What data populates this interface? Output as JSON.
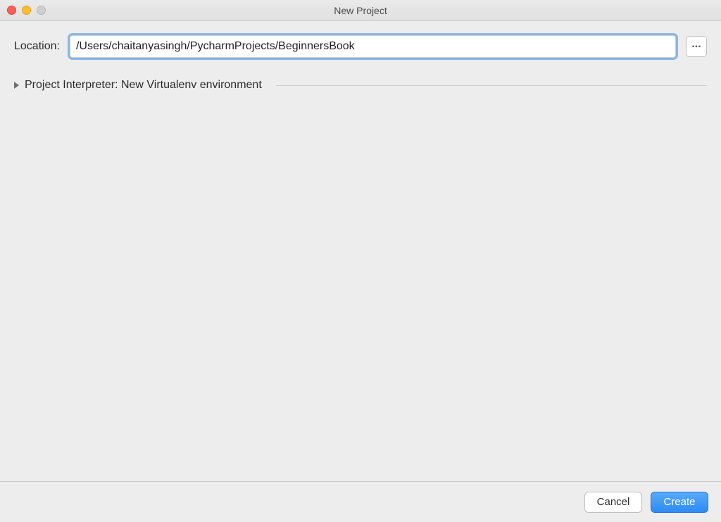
{
  "window": {
    "title": "New Project"
  },
  "location": {
    "label": "Location:",
    "value": "/Users/chaitanyasingh/PycharmProjects/BeginnersBook",
    "browse_label": "..."
  },
  "interpreter": {
    "label": "Project Interpreter:",
    "value": "New Virtualenv environment"
  },
  "buttons": {
    "cancel": "Cancel",
    "create": "Create"
  }
}
